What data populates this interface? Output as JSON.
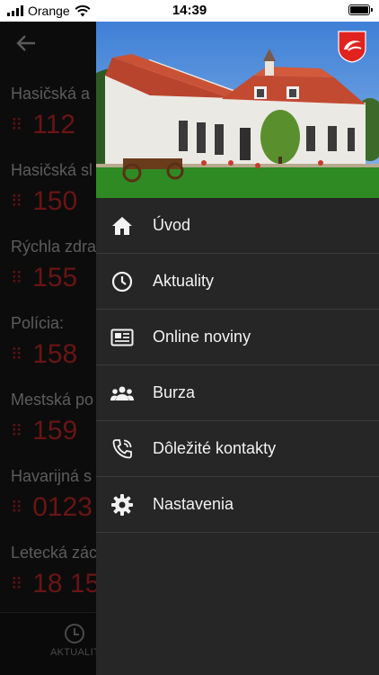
{
  "status_bar": {
    "carrier": "Orange",
    "time": "14:39"
  },
  "background_screen": {
    "contacts": [
      {
        "name": "Hasičská a",
        "number": "112"
      },
      {
        "name": "Hasičská sl",
        "number": "150"
      },
      {
        "name": "Rýchla zdra",
        "number": "155"
      },
      {
        "name": "Polícia:",
        "number": "158"
      },
      {
        "name": "Mestská po",
        "number": "159"
      },
      {
        "name": "Havarijná s",
        "number": "0123"
      },
      {
        "name": "Letecká zác",
        "number": "18 15"
      }
    ],
    "bottom_nav": {
      "label": "AKTUALIT",
      "icon": "clock-icon"
    }
  },
  "drawer": {
    "menu": [
      {
        "label": "Úvod",
        "icon": "home-icon"
      },
      {
        "label": "Aktuality",
        "icon": "clock-icon"
      },
      {
        "label": "Online noviny",
        "icon": "newspaper-icon"
      },
      {
        "label": "Burza",
        "icon": "people-icon"
      },
      {
        "label": "Dôležité kontakty",
        "icon": "phone-call-icon"
      },
      {
        "label": "Nastavenia",
        "icon": "gear-icon"
      }
    ]
  },
  "colors": {
    "drawer_bg": "#262626",
    "accent_red": "#6a1414",
    "crest_red": "#e0231e"
  }
}
